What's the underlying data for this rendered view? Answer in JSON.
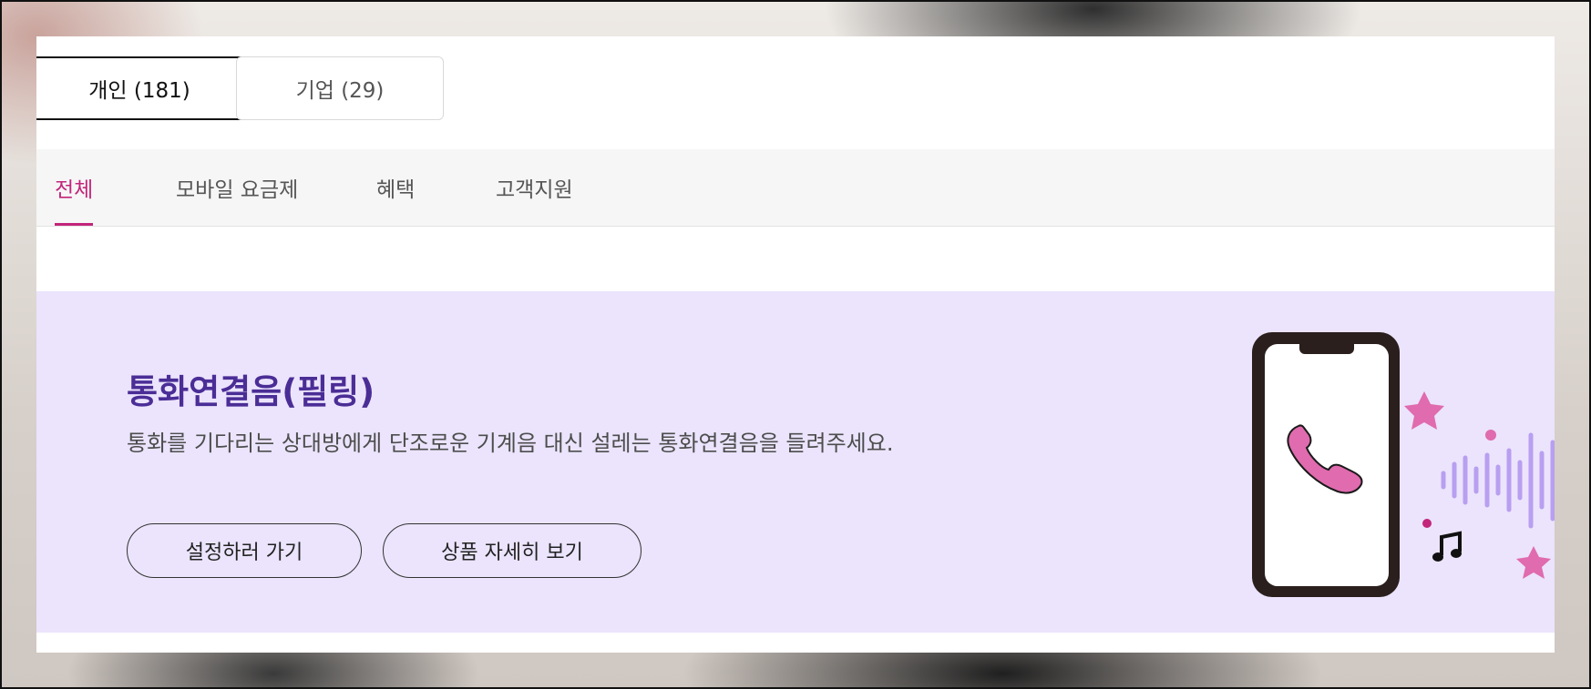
{
  "segments": [
    {
      "label": "개인 (181)",
      "active": true
    },
    {
      "label": "기업 (29)",
      "active": false
    }
  ],
  "tabs": [
    {
      "label": "전체",
      "active": true
    },
    {
      "label": "모바일 요금제",
      "active": false
    },
    {
      "label": "혜택",
      "active": false
    },
    {
      "label": "고객지원",
      "active": false
    }
  ],
  "banner": {
    "title": "통화연결음(필링)",
    "description": "통화를 기다리는 상대방에게 단조로운 기계음 대신 설레는 통화연결음을 들려주세요.",
    "setup_button": "설정하러 가기",
    "details_button": "상품 자세히 보기"
  },
  "colors": {
    "accent": "#c2257a",
    "banner_bg": "#ebe4fc",
    "title": "#4b2d96"
  },
  "icons": [
    "phone-illustration",
    "phone-handset-icon",
    "star-icon",
    "music-note-icon",
    "sound-wave-icon"
  ]
}
